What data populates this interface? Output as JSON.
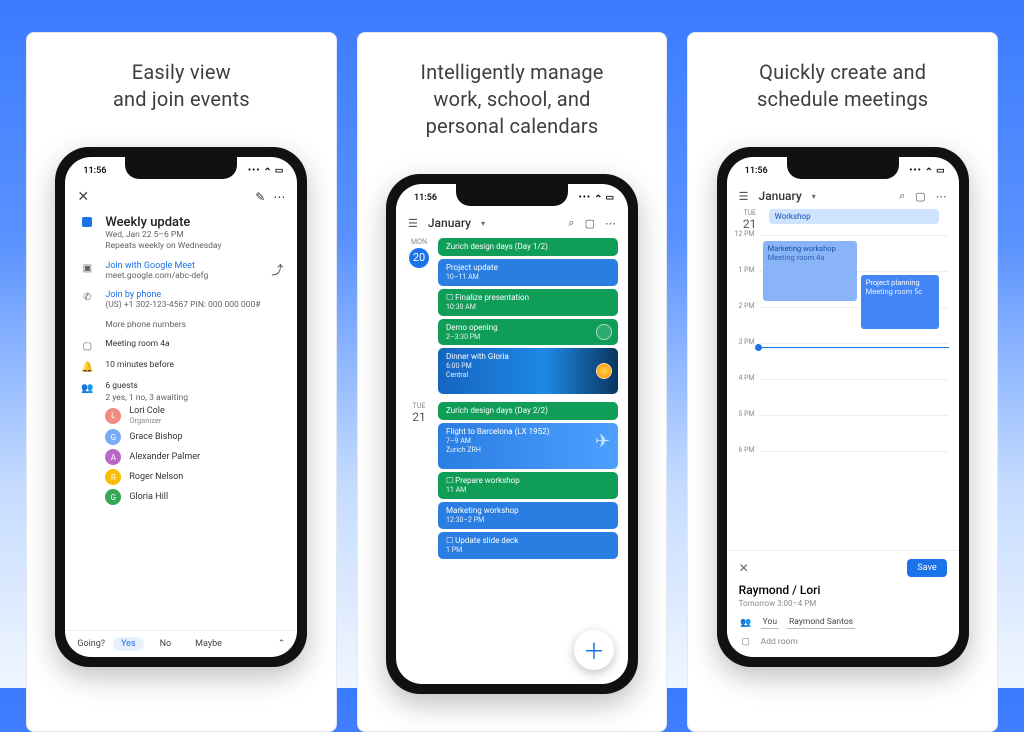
{
  "captions": {
    "p1a": "Easily view",
    "p1b": "and join events",
    "p2a": "Intelligently manage",
    "p2b": "work, school, and",
    "p2c": "personal calendars",
    "p3a": "Quickly create and",
    "p3b": "schedule meetings"
  },
  "status_time": "11:56",
  "panel1": {
    "title": "Weekly update",
    "when": "Wed, Jan 22   5–6 PM",
    "repeat": "Repeats weekly on Wednesday",
    "meet": "Join with Google Meet",
    "meet_url": "meet.google.com/abc-defg",
    "phone": "Join by phone",
    "phone_num": "(US) +1 302-123-4567 PIN: 000 000 000#",
    "more_phone": "More phone numbers",
    "room": "Meeting room 4a",
    "remind": "10 minutes before",
    "guests_hdr": "6 guests",
    "guests_sub": "2 yes, 1 no, 3 awaiting",
    "g1": "Lori Cole",
    "g1s": "Organizer",
    "g2": "Grace Bishop",
    "g3": "Alexander Palmer",
    "g4": "Roger Nelson",
    "g5": "Gloria Hill",
    "rsvp_q": "Going?",
    "yes": "Yes",
    "no": "No",
    "maybe": "Maybe"
  },
  "panel2": {
    "month": "January",
    "d1w": "MON",
    "d1n": "20",
    "d2w": "TUE",
    "d2n": "21",
    "e1": "Zurich design days (Day 1/2)",
    "e2": "Project update",
    "e2t": "10–11 AM",
    "e3": "Finalize presentation",
    "e3t": "10:30 AM",
    "e4": "Demo opening",
    "e4t": "2–3:30 PM",
    "e5": "Dinner with Gloria",
    "e5t": "6:00 PM",
    "e5l": "Central",
    "e6": "Zurich design days (Day 2/2)",
    "e7": "Flight to Barcelona (LX 1952)",
    "e7t": "7–9 AM",
    "e7l": "Zurich ZRH",
    "e8": "Prepare workshop",
    "e8t": "11 AM",
    "e9": "Marketing workshop",
    "e9t": "12:30–2 PM",
    "e10": "Update slide deck",
    "e10t": "1 PM"
  },
  "panel3": {
    "month": "January",
    "dw": "TUE",
    "dn": "21",
    "allday": "Workshop",
    "h1": "12 PM",
    "h2": "1 PM",
    "h3": "2 PM",
    "h4": "3 PM",
    "h5": "4 PM",
    "h6": "5 PM",
    "h7": "6 PM",
    "ev1": "Marketing workshop",
    "ev1s": "Meeting room 4a",
    "ev2": "Project planning",
    "ev2s": "Meeting room 5c",
    "save": "Save",
    "sheet_title": "Raymond / Lori",
    "sheet_sub": "Tomorrow   3:00–4 PM",
    "you": "You",
    "guest": "Raymond Santos",
    "addroom": "Add room"
  }
}
